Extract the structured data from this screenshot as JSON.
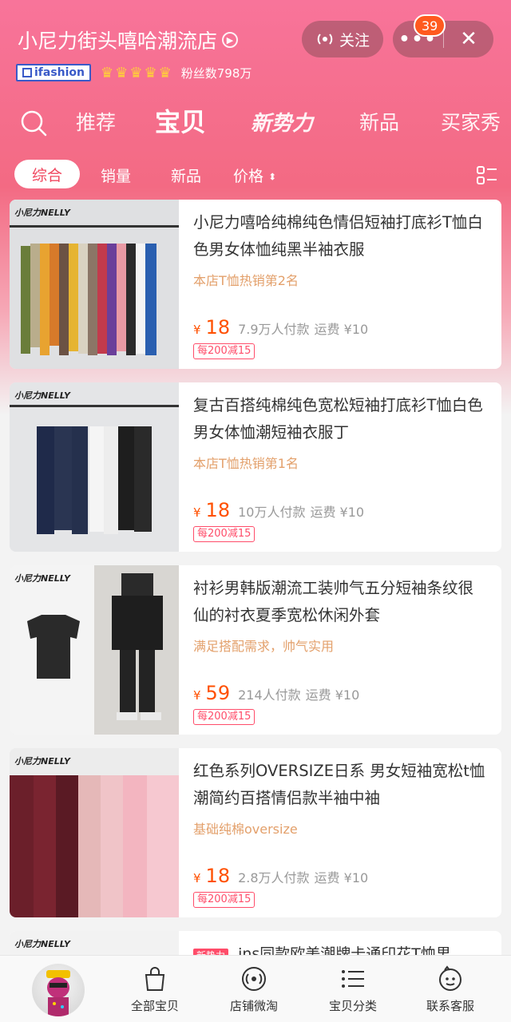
{
  "header": {
    "shop_name": "小尼力街头嘻哈潮流店",
    "follow_label": "关注",
    "notification_count": "39",
    "ifashion_label": "ifashion",
    "fans_text": "粉丝数798万"
  },
  "nav": {
    "tabs": [
      {
        "label": "推荐"
      },
      {
        "label": "宝贝"
      },
      {
        "label": "新势力"
      },
      {
        "label": "新品"
      },
      {
        "label": "买家秀"
      }
    ]
  },
  "filters": {
    "items": [
      {
        "label": "综合"
      },
      {
        "label": "销量"
      },
      {
        "label": "新品"
      },
      {
        "label": "价格"
      }
    ]
  },
  "products": [
    {
      "title": "小尼力嘻哈纯棉纯色情侣短袖打底衫T恤白色男女体恤纯黑半袖衣服",
      "tag": "本店T恤热销第2名",
      "currency": "¥",
      "price": "18",
      "paid": "7.9万人付款",
      "shipping": "运费 ¥10",
      "coupon": "每200减15",
      "brand_logo": "小尼力NELLY"
    },
    {
      "title": "复古百搭纯棉纯色宽松短袖打底衫T恤白色男女体恤潮短袖衣服丁",
      "tag": "本店T恤热销第1名",
      "currency": "¥",
      "price": "18",
      "paid": "10万人付款",
      "shipping": "运费 ¥10",
      "coupon": "每200减15",
      "brand_logo": "小尼力NELLY"
    },
    {
      "title": "衬衫男韩版潮流工装帅气五分短袖条纹很仙的衬衣夏季宽松休闲外套",
      "tag": "满足搭配需求，帅气实用",
      "currency": "¥",
      "price": "59",
      "paid": "214人付款",
      "shipping": "运费 ¥10",
      "coupon": "每200减15",
      "brand_logo": "小尼力NELLY"
    },
    {
      "title": "红色系列OVERSIZE日系 男女短袖宽松t恤潮简约百搭情侣款半袖中袖",
      "tag": "基础纯棉oversize",
      "currency": "¥",
      "price": "18",
      "paid": "2.8万人付款",
      "shipping": "运费 ¥10",
      "coupon": "每200减15",
      "brand_logo": "小尼力NELLY"
    }
  ],
  "partial_product": {
    "badge": "新势力",
    "title": "ins同款欧美潮牌卡通印花T恤男",
    "brand_logo": "小尼力NELLY"
  },
  "bottom_bar": {
    "items": [
      {
        "label": "全部宝贝"
      },
      {
        "label": "店铺微淘"
      },
      {
        "label": "宝贝分类"
      },
      {
        "label": "联系客服"
      }
    ]
  },
  "colors": {
    "accent": "#ff5000",
    "coupon": "#ff4d6a",
    "tag": "#e3a06b",
    "header_top": "#f8749a"
  }
}
